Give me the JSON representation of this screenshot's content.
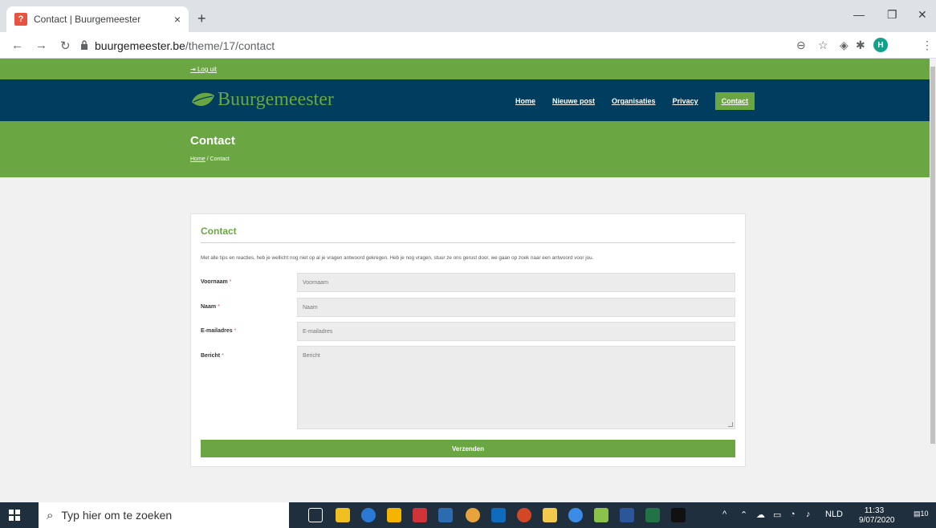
{
  "browser": {
    "tab_title": "Contact | Buurgemeester",
    "tab_close": "×",
    "new_tab": "+",
    "url_domain": "buurgemeester.be",
    "url_path": "/theme/17/contact",
    "profile_initial": "H"
  },
  "site": {
    "logout_label": "Log uit",
    "logo_text": "Buurgemeester",
    "nav": [
      "Home",
      "Nieuwe post",
      "Organisaties",
      "Privacy",
      "Contact"
    ],
    "active_nav": "Contact",
    "page_title": "Contact",
    "breadcrumb_home": "Home",
    "breadcrumb_sep": "/",
    "breadcrumb_current": "Contact",
    "accent_color": "#6aa642",
    "navbar_color": "#003d5e"
  },
  "form": {
    "heading": "Contact",
    "intro": "Met alle tips en reacties, heb je wellicht nog niet op al je vragen antwoord gekregen. Heb je nog vragen, stuur ze ons gerust door, we gaan op zoek naar een antwoord voor jou.",
    "required_mark": "*",
    "fields": [
      {
        "label": "Voornaam",
        "placeholder": "Voornaam"
      },
      {
        "label": "Naam",
        "placeholder": "Naam"
      },
      {
        "label": "E-mailadres",
        "placeholder": "E-mailadres"
      },
      {
        "label": "Bericht",
        "placeholder": "Bericht"
      }
    ],
    "submit_label": "Verzenden"
  },
  "taskbar": {
    "search_placeholder": "Typ hier om te zoeken",
    "language": "NLD",
    "time": "11:33",
    "date": "9/07/2020",
    "notification_count": "10"
  }
}
